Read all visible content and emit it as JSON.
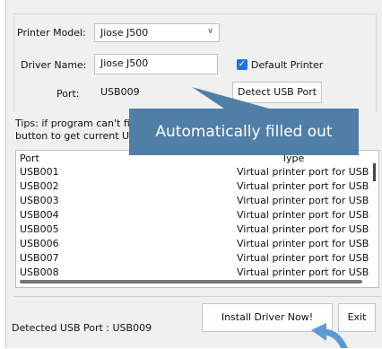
{
  "form": {
    "printer_model_label": "Printer Model:",
    "printer_model_value": "Jiose J500",
    "driver_name_label": "Driver Name:",
    "driver_name_value": "Jiose J500",
    "default_printer_label": "Default Printer",
    "default_printer_checked": true,
    "port_label": "Port:",
    "port_value": "USB009",
    "detect_button": "Detect USB Port"
  },
  "tips": {
    "line1": "Tips: if program can't find U",
    "line2": "button to get current USB"
  },
  "overlay": {
    "text": "Automatically filled out"
  },
  "port_list": {
    "columns": [
      "Port",
      "Type"
    ],
    "rows": [
      {
        "port": "USB001",
        "type": "Virtual printer port for USB"
      },
      {
        "port": "USB002",
        "type": "Virtual printer port for USB"
      },
      {
        "port": "USB003",
        "type": "Virtual printer port for USB"
      },
      {
        "port": "USB004",
        "type": "Virtual printer port for USB"
      },
      {
        "port": "USB005",
        "type": "Virtual printer port for USB"
      },
      {
        "port": "USB006",
        "type": "Virtual printer port for USB"
      },
      {
        "port": "USB007",
        "type": "Virtual printer port for USB"
      },
      {
        "port": "USB008",
        "type": "Virtual printer port for USB"
      }
    ]
  },
  "footer": {
    "detected_text": "Detected USB Port : USB009",
    "install_button": "Install Driver Now!",
    "exit_button": "Exit"
  },
  "colors": {
    "overlay": "#4f7ea6",
    "arrow": "#5b9bd5",
    "checkbox": "#1a73e8"
  },
  "icons": {
    "dropdown": "chevron-down-icon",
    "checkbox": "checkmark-icon",
    "pointer": "curved-arrow-icon"
  }
}
